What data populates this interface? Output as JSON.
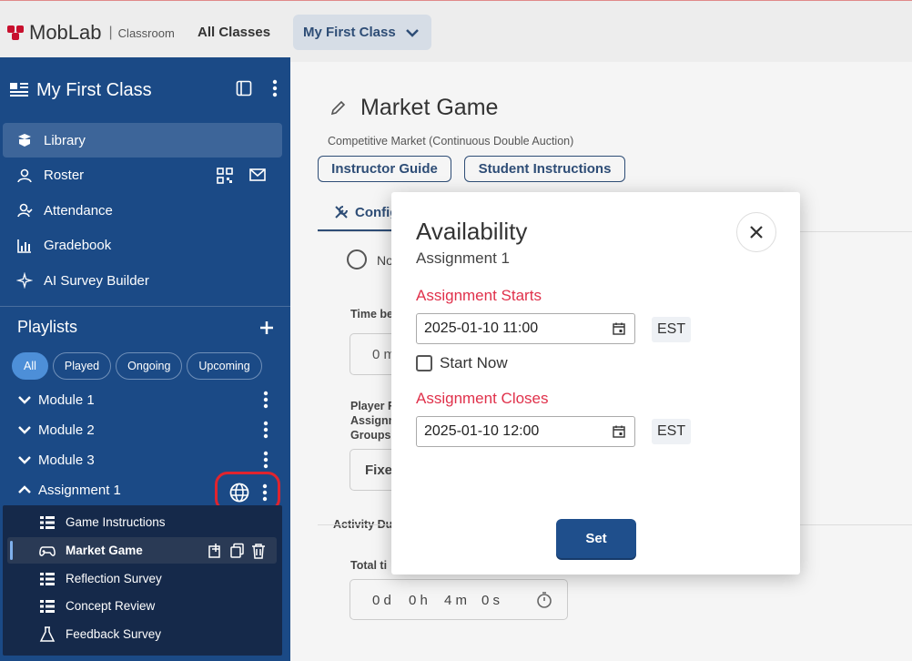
{
  "topbar": {
    "brand": "MobLab",
    "brand_sub": "Classroom",
    "all_classes": "All Classes",
    "class_selector": "My First Class",
    "brand_color": "#c8102e"
  },
  "sidebar": {
    "title": "My First Class",
    "nav": [
      {
        "label": "Library",
        "icon": "library-icon",
        "active": true
      },
      {
        "label": "Roster",
        "icon": "roster-icon"
      },
      {
        "label": "Attendance",
        "icon": "attendance-icon"
      },
      {
        "label": "Gradebook",
        "icon": "gradebook-icon"
      },
      {
        "label": "AI Survey Builder",
        "icon": "sparkle-icon"
      }
    ],
    "playlists_label": "Playlists",
    "chips": [
      "All",
      "Played",
      "Ongoing",
      "Upcoming"
    ],
    "modules": [
      "Module 1",
      "Module 2",
      "Module 3",
      "Assignment 1"
    ],
    "assignment_items": [
      {
        "label": "Game Instructions",
        "icon": "list-icon"
      },
      {
        "label": "Market Game",
        "icon": "gamepad-icon",
        "active": true
      },
      {
        "label": "Reflection Survey",
        "icon": "list-icon"
      },
      {
        "label": "Concept Review",
        "icon": "list-icon"
      },
      {
        "label": "Feedback Survey",
        "icon": "flask-icon"
      }
    ],
    "bg_color": "#1b4a86"
  },
  "main": {
    "title": "Market Game",
    "subtitle": "Competitive Market (Continuous Double Auction)",
    "instructor_guide": "Instructor Guide",
    "student_instructions": "Student Instructions",
    "tab_config": "Config",
    "radio_partial": "No",
    "time_label_partial": "Time be",
    "time_value_partial": "0 m",
    "player_label_1": "Player R",
    "player_label_2": "Assignm",
    "player_label_3": "Groups",
    "fixed_partial": "Fixe",
    "activity_partial": "Activity Du",
    "total_time_partial": "Total ti",
    "duration": {
      "d": "0 d",
      "h": "0 h",
      "m": "4 m",
      "s": "0 s"
    }
  },
  "dialog": {
    "title": "Availability",
    "subtitle": "Assignment 1",
    "starts_label": "Assignment Starts",
    "starts_value": "2025-01-10 11:00",
    "start_now_label": "Start Now",
    "closes_label": "Assignment Closes",
    "closes_value": "2025-01-10 12:00",
    "tz": "EST",
    "set_label": "Set",
    "label_color": "#e0314b"
  }
}
